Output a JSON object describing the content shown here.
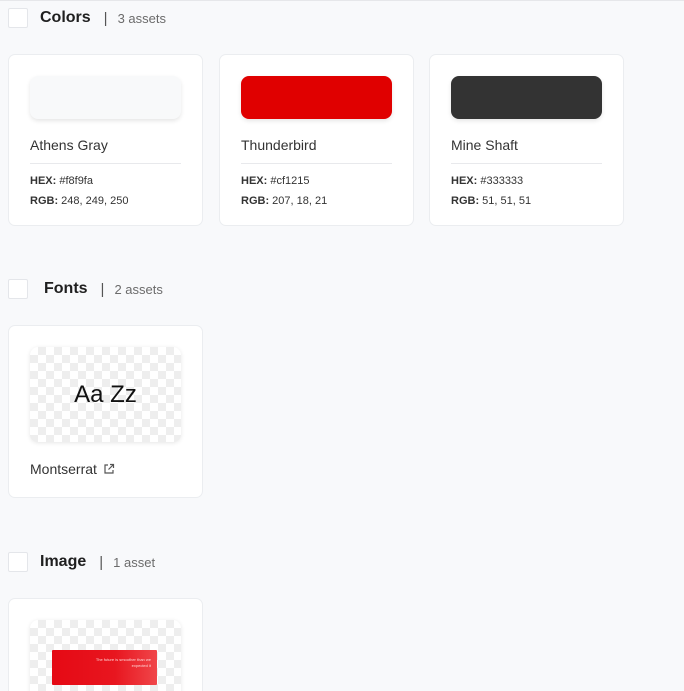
{
  "sections": {
    "colors": {
      "title": "Colors",
      "separator": "|",
      "count": "3 assets"
    },
    "fonts": {
      "title": "Fonts",
      "separator": "|",
      "count": "2 assets"
    },
    "image": {
      "title": "Image",
      "separator": "|",
      "count": "1 asset"
    }
  },
  "colors": [
    {
      "name": "Athens Gray",
      "hex_label": "HEX:",
      "hex": "#f8f9fa",
      "rgb_label": "RGB:",
      "rgb": "248, 249, 250",
      "swatch": "#f8f9fa"
    },
    {
      "name": "Thunderbird",
      "hex_label": "HEX:",
      "hex": "#cf1215",
      "rgb_label": "RGB:",
      "rgb": "207, 18, 21",
      "swatch": "#e00000"
    },
    {
      "name": "Mine Shaft",
      "hex_label": "HEX:",
      "hex": "#333333",
      "rgb_label": "RGB:",
      "rgb": "51, 51, 51",
      "swatch": "#333333"
    }
  ],
  "fonts": [
    {
      "sample": "Aa Zz",
      "name": "Montserrat",
      "icon": "external-link-icon"
    }
  ],
  "images": [
    {
      "caption": "The future is smoother than we expected it"
    }
  ]
}
